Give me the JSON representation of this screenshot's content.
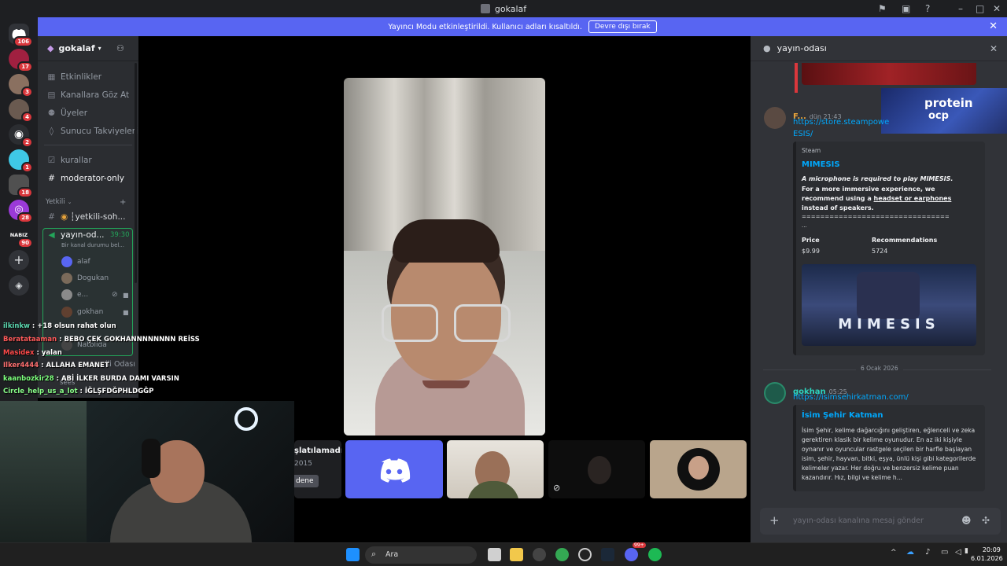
{
  "window": {
    "title": "gokalaf"
  },
  "banner": {
    "text": "Yayıncı Modu etkinleştirildi. Kullanıcı adları kısaltıldı.",
    "button": "Devre dışı bırak"
  },
  "rail": {
    "badges": [
      "106",
      "17",
      "3",
      "4",
      "2",
      "1",
      "18",
      "28",
      "90"
    ],
    "nabiz_label": "NABIZ"
  },
  "sidebar": {
    "server_name": "gokalaf",
    "items": [
      "Etkinlikler",
      "Kanallara Göz At",
      "Üyeler",
      "Sunucu Takviyeleri"
    ],
    "channels": [
      "kurallar",
      "moderator-only"
    ],
    "category": "Yetkili",
    "text_channel": "┆yetkili-soh...",
    "voice": {
      "name": "yayın-od...",
      "timer": "39:30",
      "status": "Bir kanal durumu bel..."
    },
    "voice_users": [
      "alaf",
      "Dogukan",
      "e...",
      "gokhan",
      "Natblida"
    ],
    "hidden_channel": "ili Odası",
    "hidden_user": "sees"
  },
  "overlay_chat": [
    {
      "user": "ilkinkw",
      "color": "#5bd8b0",
      "text": " : +18 olsun rahat olun"
    },
    {
      "user": "Beratataaman",
      "color": "#ff5a5a",
      "text": " : BEBO ÇEK GOKHANNNNNNNN REİSS"
    },
    {
      "user": "Masidex",
      "color": "#ff4a4a",
      "text": " : yalan"
    },
    {
      "user": "Ilker4444",
      "color": "#ff7070",
      "text": " : ALLAHA EMANET"
    },
    {
      "user": "kaanbozkir28",
      "color": "#7cff7c",
      "text": " : ABİ İLKER BURDA DAMI VARSIN"
    },
    {
      "user": "Circle_help_us_a_lot",
      "color": "#8aff8a",
      "text": " : İĞLŞFDĞPHLDGĞP"
    }
  ],
  "stage": {
    "activity": {
      "line1": "şlatılamadı",
      "line2": "2015",
      "button": "dene"
    }
  },
  "chat": {
    "channel": "yayın-odası",
    "msg1": {
      "author": "F...",
      "time": "dün 21:43",
      "link1": "https://store.steampowe",
      "link2": "ESIS/"
    },
    "embed1": {
      "provider": "Steam",
      "title": "MIMESIS",
      "bold": "A microphone is required to play MIMESIS.",
      "desc_a": "For a more immersive experience, we recommend using a ",
      "desc_u": "headset or earphones",
      "desc_b": " instead of speakers.",
      "rule": "================================",
      "dots": "...",
      "price_label": "Price",
      "price": "$9.99",
      "rec_label": "Recommendations",
      "rec": "5724",
      "image_text": "MIMESIS"
    },
    "date_divider": "6 Ocak 2026",
    "msg2": {
      "author": "gokhan",
      "time": "05:25",
      "link": "https://isimsehirkatman.com/"
    },
    "embed2": {
      "title": "İsim Şehir Katman",
      "desc": "İsim Şehir, kelime dağarcığını geliştiren, eğlenceli ve zeka gerektiren klasik bir kelime oyunudur. En az iki kişiyle oynanır ve oyuncular rastgele seçilen bir harfle başlayan isim, şehir, hayvan, bitki, eşya, ünlü kişi gibi kategorilerde kelimeler yazar. Her doğru ve benzersiz kelime puan kazandırır. Hız, bilgi ve kelime h..."
    },
    "promo": {
      "line1": "protein",
      "line2": "ocp"
    },
    "input_placeholder": "yayın-odası kanalına mesaj gönder"
  },
  "taskbar": {
    "search": "Ara",
    "time": "20:09",
    "date": "6.01.2026",
    "notif": "99+"
  },
  "colors": {
    "accent": "#5865f2",
    "link": "#00a8fc",
    "voice_green": "#23a55a"
  }
}
